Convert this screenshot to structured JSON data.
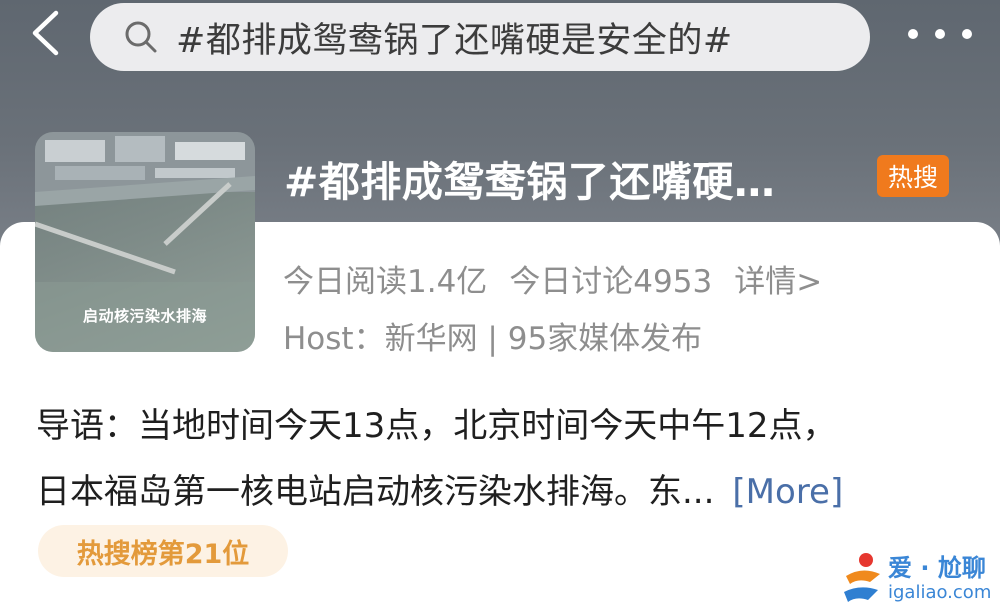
{
  "header": {
    "search_query": "#都排成鸳鸯锅了还嘴硬是安全的#"
  },
  "topic": {
    "title": "#都排成鸳鸯锅了还嘴硬…",
    "badge": "热搜",
    "thumbnail_caption": "启动核污染水排海",
    "reads": "今日阅读1.4亿",
    "discussions": "今日讨论4953",
    "details_link": "详情>",
    "host": "Host：新华网 | 95家媒体发布"
  },
  "intro": {
    "line1": "导语：当地时间今天13点，北京时间今天中午12点，",
    "line2": "日本福岛第一核电站启动核污染水排海。东...",
    "more": "[More]"
  },
  "rank": {
    "label": "热搜榜第21位"
  },
  "watermark": {
    "name": "爱 · 尬聊",
    "url": "igaliao.com"
  },
  "colors": {
    "header_bg": "#656c74",
    "hot_badge": "#f07a1d",
    "more_link": "#4a6fa8",
    "rank_text": "#e39a3b",
    "watermark": "#3a86d6"
  },
  "icons": {
    "back": "chevron-left-icon",
    "search": "search-icon",
    "more": "more-dots-icon"
  }
}
